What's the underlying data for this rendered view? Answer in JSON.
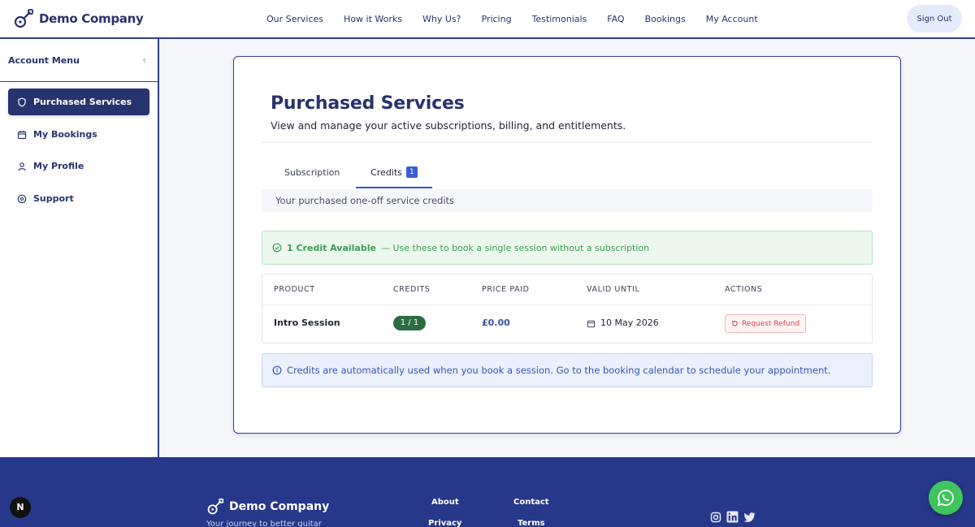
{
  "brand": {
    "name": "Demo Company"
  },
  "nav": {
    "items": [
      "Our Services",
      "How it Works",
      "Why Us?",
      "Pricing",
      "Testimonials",
      "FAQ",
      "Bookings",
      "My Account"
    ],
    "sign_out": "Sign Out"
  },
  "sidebar": {
    "title": "Account Menu",
    "items": [
      {
        "label": "Purchased Services",
        "icon": "shield-icon",
        "active": true
      },
      {
        "label": "My Bookings",
        "icon": "calendar-icon",
        "active": false
      },
      {
        "label": "My Profile",
        "icon": "user-icon",
        "active": false
      },
      {
        "label": "Support",
        "icon": "help-circle-icon",
        "active": false
      }
    ]
  },
  "main": {
    "title": "Purchased Services",
    "subtitle": "View and manage your active subscriptions, billing, and entitlements.",
    "tabs": [
      {
        "label": "Subscription",
        "active": false
      },
      {
        "label": "Credits",
        "badge": "1",
        "active": true
      }
    ],
    "tab_description": "Your purchased one-off service credits",
    "credits_alert": {
      "strong": "1 Credit Available",
      "text": "— Use these to book a single session without a subscription"
    },
    "table": {
      "headers": [
        "PRODUCT",
        "CREDITS",
        "PRICE PAID",
        "VALID UNTIL",
        "ACTIONS"
      ],
      "rows": [
        {
          "product": "Intro Session",
          "credits": "1 / 1",
          "price": "£0.00",
          "valid_until": "10 May 2026",
          "action": "Request Refund"
        }
      ]
    },
    "info_alert": "Credits are automatically used when you book a session. Go to the booking calendar to schedule your appointment."
  },
  "footer": {
    "brand": "Demo Company",
    "tagline": "Your journey to better guitar",
    "links": [
      "About",
      "Contact",
      "Privacy",
      "Terms"
    ]
  },
  "colors": {
    "primary": "#27336e",
    "accent_blue": "#3b5ed8",
    "success": "#3aa154",
    "danger": "#d84848",
    "footer_bg": "#27388a",
    "whatsapp": "#3fc55b"
  }
}
